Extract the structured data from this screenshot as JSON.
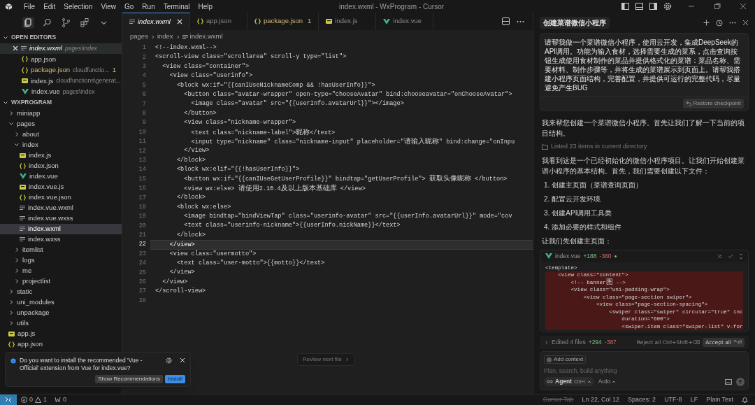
{
  "title_bar": {
    "menu": [
      "File",
      "Edit",
      "Selection",
      "View",
      "Go",
      "Run",
      "Terminal",
      "Help"
    ],
    "title": "index.wxml - WxProgram - Cursor"
  },
  "sidebar_tools": [
    {
      "kind": "files",
      "selected": true
    },
    {
      "kind": "search",
      "selected": false
    },
    {
      "kind": "branch",
      "selected": false
    },
    {
      "kind": "extensions",
      "selected": false
    },
    {
      "kind": "more",
      "selected": false
    }
  ],
  "open_editors": {
    "title": "OPEN EDITORS",
    "items": [
      {
        "name": "index.wxml",
        "path": "pages\\index",
        "kind": "lines",
        "selected": true
      },
      {
        "name": "app.json",
        "kind": "json",
        "selected": false
      },
      {
        "name": "package.json",
        "path": "cloudfunctio...",
        "kind": "json",
        "selected": false,
        "problems": "1"
      },
      {
        "name": "index.js",
        "path": "cloudfunctions\\generat...",
        "kind": "js",
        "selected": false
      },
      {
        "name": "index.vue",
        "path": "pages\\index",
        "kind": "vue",
        "selected": false
      }
    ]
  },
  "workspace": {
    "title": "WXPROGRAM",
    "tree": [
      {
        "name": "miniapp",
        "kind": "folder",
        "expanded": false,
        "selected": false
      },
      {
        "name": "pages",
        "kind": "folder",
        "expanded": true,
        "selected": false,
        "children": [
          {
            "name": "about",
            "kind": "folder",
            "expanded": false,
            "selected": false
          },
          {
            "name": "index",
            "kind": "folder",
            "expanded": true,
            "selected": false,
            "children": [
              {
                "name": "index.js",
                "kind": "js",
                "selected": false
              },
              {
                "name": "index.json",
                "kind": "json",
                "selected": false
              },
              {
                "name": "index.vue",
                "kind": "vue",
                "selected": false
              },
              {
                "name": "index.vue.js",
                "kind": "js",
                "selected": false
              },
              {
                "name": "index.vue.json",
                "kind": "json",
                "selected": false
              },
              {
                "name": "index.vue.wxml",
                "kind": "lines",
                "selected": false
              },
              {
                "name": "index.vue.wxss",
                "kind": "lines",
                "selected": false
              },
              {
                "name": "index.wxml",
                "kind": "lines",
                "selected": true
              },
              {
                "name": "index.wxss",
                "kind": "lines",
                "selected": false
              }
            ]
          },
          {
            "name": "itemlist",
            "kind": "folder",
            "expanded": false,
            "selected": false
          },
          {
            "name": "logs",
            "kind": "folder",
            "expanded": false,
            "selected": false
          },
          {
            "name": "me",
            "kind": "folder",
            "expanded": false,
            "selected": false
          },
          {
            "name": "projectlist",
            "kind": "folder",
            "expanded": false,
            "selected": false
          }
        ]
      },
      {
        "name": "static",
        "kind": "folder",
        "expanded": false,
        "selected": false
      },
      {
        "name": "uni_modules",
        "kind": "folder",
        "expanded": false,
        "selected": false
      },
      {
        "name": "unpackage",
        "kind": "folder",
        "expanded": false,
        "selected": false
      },
      {
        "name": "utils",
        "kind": "folder",
        "expanded": false,
        "selected": false
      },
      {
        "name": "app.js",
        "kind": "js",
        "selected": false
      },
      {
        "name": "app.json",
        "kind": "json",
        "selected": false
      }
    ]
  },
  "notification": {
    "message": "Do you want to install the recommended 'Vue - Official' extension from Vue for index.vue?",
    "buttons": [
      {
        "label": "Show Recommendations",
        "primary": false
      },
      {
        "label": "Install",
        "primary": true
      }
    ]
  },
  "editor": {
    "tabs": [
      {
        "label": "index.wxml",
        "kind": "lines",
        "selected": true
      },
      {
        "label": "app.json",
        "kind": "json",
        "selected": false
      },
      {
        "label": "package.json",
        "kind": "json",
        "selected": false,
        "problems": "1"
      },
      {
        "label": "index.js",
        "kind": "js",
        "selected": false
      },
      {
        "label": "index.vue",
        "kind": "vue",
        "selected": false
      }
    ],
    "breadcrumb": [
      "pages",
      "index",
      "index.wxml"
    ],
    "lines": [
      {
        "number": "1",
        "text": "<!--index.wxml-->",
        "current": false
      },
      {
        "number": "2",
        "text": "<scroll-view class=\"scrollarea\" scroll-y type=\"list\">",
        "current": false
      },
      {
        "number": "3",
        "text": "  <view class=\"container\">",
        "current": false
      },
      {
        "number": "4",
        "text": "    <view class=\"userinfo\">",
        "current": false
      },
      {
        "number": "5",
        "text": "      <block wx:if=\"{{canIUseNicknameComp && !hasUserInfo}}\">",
        "current": false
      },
      {
        "number": "6",
        "text": "        <button class=\"avatar-wrapper\" open-type=\"chooseAvatar\" bind:chooseavatar=\"onChooseAvatar\">",
        "current": false
      },
      {
        "number": "7",
        "text": "          <image class=\"avatar\" src=\"{{userInfo.avatarUrl}}\"></image>",
        "current": false
      },
      {
        "number": "8",
        "text": "        </button>",
        "current": false
      },
      {
        "number": "9",
        "text": "        <view class=\"nickname-wrapper\">",
        "current": false
      },
      {
        "number": "10",
        "text": "          <text class=\"nickname-label\">昵称</text>",
        "current": false
      },
      {
        "number": "11",
        "text": "          <input type=\"nickname\" class=\"nickname-input\" placeholder=\"请输入昵称\" bind:change=\"onInpu",
        "current": false
      },
      {
        "number": "12",
        "text": "        </view>",
        "current": false
      },
      {
        "number": "13",
        "text": "      </block>",
        "current": false
      },
      {
        "number": "14",
        "text": "      <block wx:elif=\"{{!hasUserInfo}}\">",
        "current": false
      },
      {
        "number": "15",
        "text": "        <button wx:if=\"{{canIUseGetUserProfile}}\" bindtap=\"getUserProfile\"> 获取头像昵称 </button>",
        "current": false
      },
      {
        "number": "16",
        "text": "        <view wx:else> 请使用2.10.4及以上版本基础库 </view>",
        "current": false
      },
      {
        "number": "17",
        "text": "      </block>",
        "current": false
      },
      {
        "number": "18",
        "text": "      <block wx:else>",
        "current": false
      },
      {
        "number": "19",
        "text": "        <image bindtap=\"bindViewTap\" class=\"userinfo-avatar\" src=\"{{userInfo.avatarUrl}}\" mode=\"cov",
        "current": false
      },
      {
        "number": "20",
        "text": "        <text class=\"userinfo-nickname\">{{userInfo.nickName}}</text>",
        "current": false
      },
      {
        "number": "21",
        "text": "      </block>",
        "current": false
      },
      {
        "number": "22",
        "text": "    </view>",
        "current": true
      },
      {
        "number": "23",
        "text": "    <view class=\"usermotto\">",
        "current": false
      },
      {
        "number": "24",
        "text": "      <text class=\"user-motto\">{{motto}}</text>",
        "current": false
      },
      {
        "number": "25",
        "text": "    </view>",
        "current": false
      },
      {
        "number": "26",
        "text": "  </view>",
        "current": false
      },
      {
        "number": "27",
        "text": "</scroll-view>",
        "current": false
      },
      {
        "number": "28",
        "current": false
      }
    ],
    "review_button": "Review next file"
  },
  "chat": {
    "title": "创建菜谱微信小程序",
    "user_message": "请帮我做一个菜谱微信小程序，使用云开发，集成DeepSeek的API调用。功能为输入食材，选择需要生成的菜系，点击查询按钮生成使用食材制作的菜品并提供格式化的菜谱：菜品名称、需要材料、制作步骤等，并将生成的菜谱展示到页面上。请帮我搭建小程序页面结构，完善配置，并提供可运行的完整代码，尽量避免产生BUG",
    "restore_button": "Restore checkpoint",
    "messages": [
      {
        "kind": "text",
        "text": "我来帮您创建一个菜谱微信小程序。首先让我们了解一下当前的项目结构。"
      },
      {
        "kind": "tool",
        "text": "Listed 23 items in current directory"
      },
      {
        "kind": "text",
        "text": "我看到这是一个已经初始化的微信小程序项目。让我们开始创建菜谱小程序的基本结构。首先，我们需要创建以下文件："
      },
      {
        "kind": "list",
        "items": [
          {
            "number": "1.",
            "text": "创建主页面（菜谱查询页面）"
          },
          {
            "number": "2.",
            "text": "配置云开发环境"
          },
          {
            "number": "3.",
            "text": "创建API调用工具类"
          },
          {
            "number": "4.",
            "text": "添加必要的样式和组件"
          }
        ]
      },
      {
        "kind": "text",
        "text": "让我们先创建主页面："
      },
      {
        "kind": "diff",
        "file": "index.vue",
        "added": "+188",
        "removed": "-380",
        "lines": [
          {
            "kind": "context",
            "text": "<template>"
          },
          {
            "kind": "removed",
            "text": "    <view class=\"content\">"
          },
          {
            "kind": "removed",
            "text": "        <!-- banner图 -->"
          },
          {
            "kind": "removed",
            "text": "        <view class=\"uni-padding-wrap\">"
          },
          {
            "kind": "removed",
            "text": "            <view class=\"page-section swiper\">"
          },
          {
            "kind": "removed",
            "text": "                <view class=\"page-section-spacing\">"
          },
          {
            "kind": "removed",
            "text": "                    <swiper class=\"swiper\" circular=\"true\" inc"
          },
          {
            "kind": "removed",
            "text": "                        duration=\"600\">"
          },
          {
            "kind": "removed",
            "text": "                        <swiper-item class=\"swiper-list\" v-for"
          }
        ]
      }
    ],
    "edited_bar": {
      "summary": "Edited 4 files",
      "added": "+294",
      "removed": "-387",
      "reject": "Reject all Ctrl+Shift+⌫",
      "accept": "Accept all ^⏎"
    },
    "composer": {
      "context_button": "Add context",
      "placeholder": "Plan, search, build anything",
      "mode": "Agent",
      "mode_shortcut": "Ctrl+I",
      "model": "Auto"
    }
  },
  "status_bar": {
    "errors": "0",
    "warnings": "1",
    "ports": "0",
    "items": [
      {
        "label": "Cursor Tab",
        "disabled": true
      },
      {
        "label": "Ln 22, Col 12",
        "disabled": false
      },
      {
        "label": "Spaces: 2",
        "disabled": false
      },
      {
        "label": "UTF-8",
        "disabled": false
      },
      {
        "label": "LF",
        "disabled": false
      },
      {
        "label": "Plain Text",
        "disabled": false
      }
    ]
  }
}
